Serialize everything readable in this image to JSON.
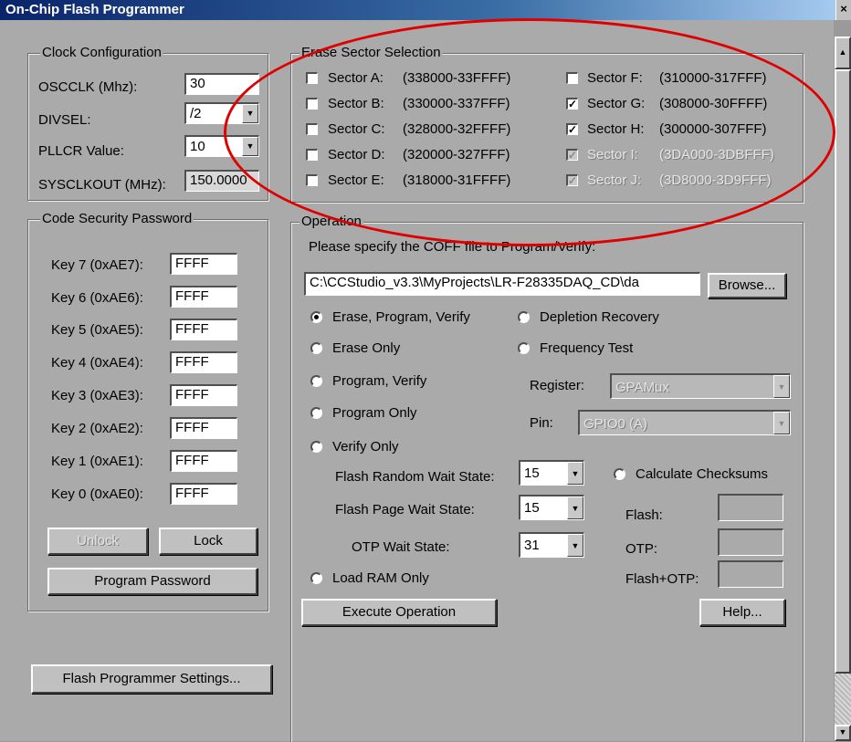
{
  "window": {
    "title": "On-Chip Flash Programmer",
    "close_glyph": "×"
  },
  "clock": {
    "legend": "Clock Configuration",
    "osc_label": "OSCCLK (Mhz):",
    "osc_value": "30",
    "divsel_label": "DIVSEL:",
    "divsel_value": "/2",
    "pllcr_label": "PLLCR Value:",
    "pllcr_value": "10",
    "sysclk_label": "SYSCLKOUT (MHz):",
    "sysclk_value": "150.0000"
  },
  "erase": {
    "legend": "Erase Sector Selection",
    "sectors": [
      {
        "label": "Sector A:",
        "range": "(338000-33FFFF)",
        "checked": false,
        "disabled": false
      },
      {
        "label": "Sector B:",
        "range": "(330000-337FFF)",
        "checked": false,
        "disabled": false
      },
      {
        "label": "Sector C:",
        "range": "(328000-32FFFF)",
        "checked": false,
        "disabled": false
      },
      {
        "label": "Sector D:",
        "range": "(320000-327FFF)",
        "checked": false,
        "disabled": false
      },
      {
        "label": "Sector E:",
        "range": "(318000-31FFFF)",
        "checked": false,
        "disabled": false
      },
      {
        "label": "Sector F:",
        "range": "(310000-317FFF)",
        "checked": false,
        "disabled": false
      },
      {
        "label": "Sector G:",
        "range": "(308000-30FFFF)",
        "checked": true,
        "disabled": false
      },
      {
        "label": "Sector H:",
        "range": "(300000-307FFF)",
        "checked": true,
        "disabled": false
      },
      {
        "label": "Sector I:",
        "range": "(3DA000-3DBFFF)",
        "checked": true,
        "disabled": true
      },
      {
        "label": "Sector J:",
        "range": "(3D8000-3D9FFF)",
        "checked": true,
        "disabled": true
      }
    ],
    "check_glyph": "✓",
    "highlight_color": "#e00000"
  },
  "security": {
    "legend": "Code Security Password",
    "keys": [
      {
        "label": "Key 7 (0xAE7):",
        "value": "FFFF"
      },
      {
        "label": "Key 6 (0xAE6):",
        "value": "FFFF"
      },
      {
        "label": "Key 5 (0xAE5):",
        "value": "FFFF"
      },
      {
        "label": "Key 4 (0xAE4):",
        "value": "FFFF"
      },
      {
        "label": "Key 3 (0xAE3):",
        "value": "FFFF"
      },
      {
        "label": "Key 2 (0xAE2):",
        "value": "FFFF"
      },
      {
        "label": "Key 1 (0xAE1):",
        "value": "FFFF"
      },
      {
        "label": "Key 0 (0xAE0):",
        "value": "FFFF"
      }
    ],
    "unlock_label": "Unlock",
    "lock_label": "Lock",
    "program_password_label": "Program Password"
  },
  "settings_button": "Flash Programmer Settings...",
  "operation": {
    "legend": "Operation",
    "coff_prompt": "Please specify the COFF file to Program/Verify:",
    "coff_path": "C:\\CCStudio_v3.3\\MyProjects\\LR-F28335DAQ_CD\\da",
    "browse_label": "Browse...",
    "modes": [
      {
        "label": "Erase, Program, Verify",
        "selected": true
      },
      {
        "label": "Erase Only",
        "selected": false
      },
      {
        "label": "Program, Verify",
        "selected": false
      },
      {
        "label": "Program Only",
        "selected": false
      },
      {
        "label": "Verify Only",
        "selected": false
      },
      {
        "label": "Load RAM Only",
        "selected": false
      }
    ],
    "depletion_label": "Depletion Recovery",
    "frequency_label": "Frequency Test",
    "register_label": "Register:",
    "register_value": "GPAMux",
    "pin_label": "Pin:",
    "pin_value": "GPIO0 (A)",
    "random_wait_label": "Flash Random Wait State:",
    "random_wait_value": "15",
    "page_wait_label": "Flash Page Wait State:",
    "page_wait_value": "15",
    "otp_wait_label": "OTP Wait State:",
    "otp_wait_value": "31",
    "checksum_label": "Calculate Checksums",
    "flash_label": "Flash:",
    "otp_label": "OTP:",
    "flash_otp_label": "Flash+OTP:",
    "flash_value": "",
    "otp_value": "",
    "flash_otp_value": "",
    "execute_label": "Execute Operation",
    "help_label": "Help..."
  },
  "icons": {
    "dropdown": "▼",
    "scroll_up": "▲",
    "scroll_down": "▼"
  }
}
